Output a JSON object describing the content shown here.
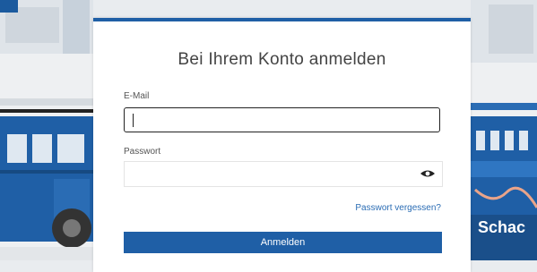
{
  "login": {
    "title": "Bei Ihrem Konto anmelden",
    "email_label": "E-Mail",
    "email_value": "",
    "password_label": "Passwort",
    "password_value": "",
    "forgot_link": "Passwort vergessen?",
    "submit_label": "Anmelden",
    "show_password_icon": "eye-icon"
  },
  "background": {
    "sign_text": "Schac",
    "accent_color": "#1f5fa6"
  }
}
